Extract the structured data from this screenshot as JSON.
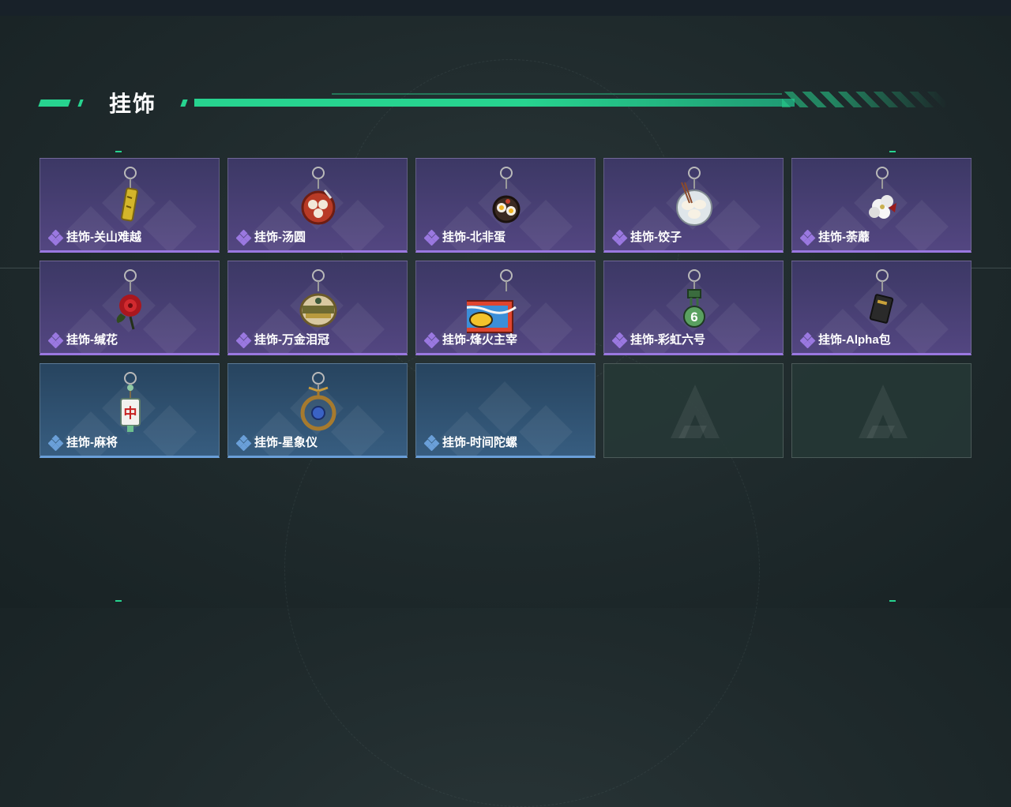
{
  "page": {
    "title": "挂饰",
    "accent_color": "#27d38f"
  },
  "rarity_colors": {
    "purple": "#9a78e0",
    "blue": "#6a9fd8"
  },
  "items": [
    {
      "name": "挂饰-关山难越",
      "rarity": "purple",
      "icon": "yellow-stick-keychain-icon"
    },
    {
      "name": "挂饰-汤圆",
      "rarity": "purple",
      "icon": "tangyuan-bowl-keychain-icon"
    },
    {
      "name": "挂饰-北非蛋",
      "rarity": "purple",
      "icon": "shakshuka-pan-keychain-icon"
    },
    {
      "name": "挂饰-饺子",
      "rarity": "purple",
      "icon": "dumplings-plate-keychain-icon"
    },
    {
      "name": "挂饰-荼蘼",
      "rarity": "purple",
      "icon": "white-flower-keychain-icon"
    },
    {
      "name": "挂饰-缄花",
      "rarity": "purple",
      "icon": "red-rose-keychain-icon"
    },
    {
      "name": "挂饰-万金泪冠",
      "rarity": "purple",
      "icon": "golden-crown-keychain-icon"
    },
    {
      "name": "挂饰-烽火主宰",
      "rarity": "purple",
      "icon": "graffiti-box-keychain-icon"
    },
    {
      "name": "挂饰-彩虹六号",
      "rarity": "purple",
      "icon": "rainbow-six-keychain-icon"
    },
    {
      "name": "挂饰-Alpha包",
      "rarity": "purple",
      "icon": "alpha-pack-keychain-icon"
    },
    {
      "name": "挂饰-麻将",
      "rarity": "blue",
      "icon": "mahjong-tile-keychain-icon"
    },
    {
      "name": "挂饰-星象仪",
      "rarity": "blue",
      "icon": "astrolabe-keychain-icon"
    },
    {
      "name": "挂饰-时间陀螺",
      "rarity": "blue",
      "icon": "spinning-top-icon"
    },
    {
      "name": "",
      "rarity": "empty",
      "icon": "empty-slot-logo-icon"
    },
    {
      "name": "",
      "rarity": "empty",
      "icon": "empty-slot-logo-icon"
    }
  ]
}
